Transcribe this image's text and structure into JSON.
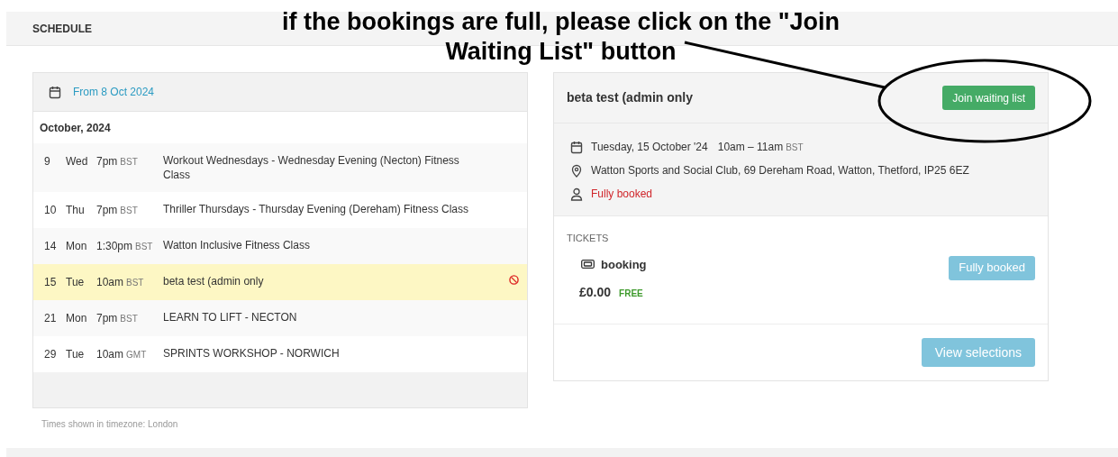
{
  "header": {
    "title": "SCHEDULE"
  },
  "annotation": {
    "text": "if the bookings are full, please click on the \"Join Waiting List\" button"
  },
  "schedule": {
    "range": "From 8 Oct 2024",
    "month": "October, 2024",
    "events": [
      {
        "day": "9",
        "weekday": "Wed",
        "time": "7pm",
        "tz": "BST",
        "title": "Workout Wednesdays - Wednesday Evening (Necton) Fitness Class",
        "selected": false,
        "full": false
      },
      {
        "day": "10",
        "weekday": "Thu",
        "time": "7pm",
        "tz": "BST",
        "title": "Thriller Thursdays - Thursday Evening (Dereham) Fitness Class",
        "selected": false,
        "full": false
      },
      {
        "day": "14",
        "weekday": "Mon",
        "time": "1:30pm",
        "tz": "BST",
        "title": "Watton Inclusive Fitness Class",
        "selected": false,
        "full": false
      },
      {
        "day": "15",
        "weekday": "Tue",
        "time": "10am",
        "tz": "BST",
        "title": "beta test (admin only",
        "selected": true,
        "full": true
      },
      {
        "day": "21",
        "weekday": "Mon",
        "time": "7pm",
        "tz": "BST",
        "title": "LEARN TO LIFT - NECTON",
        "selected": false,
        "full": false
      },
      {
        "day": "29",
        "weekday": "Tue",
        "time": "10am",
        "tz": "GMT",
        "title": "SPRINTS WORKSHOP - NORWICH",
        "selected": false,
        "full": false
      }
    ],
    "timezone_note": "Times shown in timezone: London"
  },
  "detail": {
    "title": "beta test (admin only",
    "waitlist_button": "Join waiting list",
    "date": "Tuesday, 15 October '24",
    "time": "10am – 11am",
    "tz": "BST",
    "venue": "Watton Sports and Social Club, 69 Dereham Road, Watton, Thetford, IP25 6EZ",
    "availability": "Fully booked",
    "tickets_heading": "TICKETS",
    "tickets": [
      {
        "name": "booking",
        "price": "£0.00",
        "badge": "FREE",
        "button": "Fully booked",
        "disabled": true
      }
    ],
    "view_button": "View selections"
  }
}
